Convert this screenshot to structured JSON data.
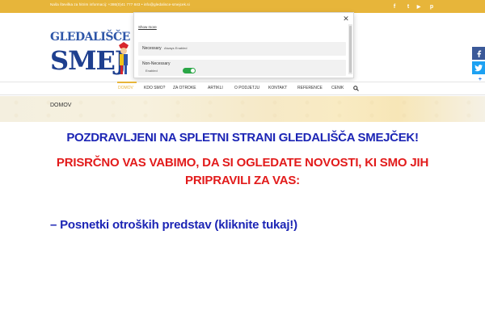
{
  "topbar": {
    "contact_text": "Naša številka za hitrim informacij: +386(0)41 777 843  •  info@gledalisce-smejcek.si",
    "social": [
      {
        "icon": "facebook-icon",
        "glyph": "f"
      },
      {
        "icon": "twitter-icon",
        "glyph": "t"
      },
      {
        "icon": "youtube-icon",
        "glyph": "▶"
      },
      {
        "icon": "pinterest-icon",
        "glyph": "p"
      }
    ]
  },
  "logo": {
    "top_text": "GLEDALIŠČE",
    "bottom_text": "SMEJ"
  },
  "cookie_popup": {
    "close_label": "✕",
    "show_more": "Show more",
    "necessary_label": "Necessary",
    "necessary_status": "Always Enabled",
    "non_necessary_label": "Non-Necessary",
    "non_necessary_status": "Enabled"
  },
  "share": {
    "facebook": "f",
    "twitter": "t",
    "more": "+"
  },
  "nav": {
    "items": [
      {
        "label": "DOMOV",
        "active": true
      },
      {
        "label": "KDO SMO?"
      },
      {
        "label": "ZA OTROKE"
      },
      {
        "label": "ARTIKLI"
      },
      {
        "label": "O PODJETJU"
      },
      {
        "label": "KONTAKT"
      },
      {
        "label": "REFERENCE"
      },
      {
        "label": "CENIK"
      }
    ],
    "search_icon": "search-icon"
  },
  "breadcrumb": "DOMOV",
  "main": {
    "greeting": "POZDRAVLJENI NA SPLETNI STRANI GLEDALIŠČA SMEJČEK!",
    "invite_line1": "PRISRČNO VAS VABIMO, DA SI OGLEDATE NOVOSTI, KI SMO JIH",
    "invite_line2": "PRIPRAVILI ZA VAS:",
    "video_link": "– Posnetki otroških predstav (kliknite tukaj!)"
  },
  "colors": {
    "accent": "#e7b53a",
    "heading_blue": "#1c25b5",
    "heading_red": "#e21b1b"
  }
}
